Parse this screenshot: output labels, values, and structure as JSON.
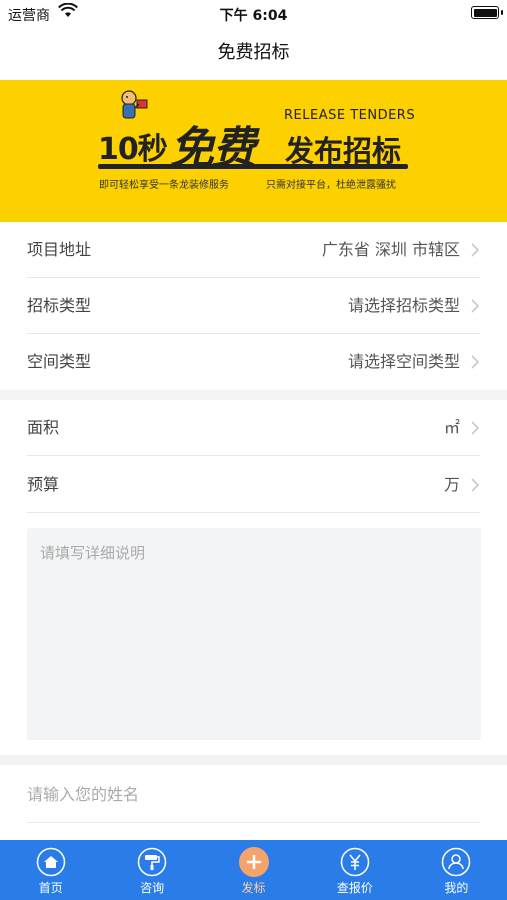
{
  "status_bar": {
    "carrier": "运营商",
    "time": "下午 6:04"
  },
  "nav": {
    "title": "免费招标"
  },
  "banner": {
    "left_text": "10秒",
    "big_text": "免费",
    "right_text": "发布招标",
    "english": "RELEASE TENDERS",
    "tagline_left": "即可轻松享受一条龙装修服务",
    "tagline_right": "只需对接平台，杜绝泄露骚扰"
  },
  "form": {
    "address": {
      "label": "项目地址",
      "value": "广东省 深圳 市辖区"
    },
    "tender_type": {
      "label": "招标类型",
      "value": "请选择招标类型"
    },
    "space_type": {
      "label": "空间类型",
      "value": "请选择空间类型"
    },
    "area": {
      "label": "面积",
      "unit": "㎡"
    },
    "budget": {
      "label": "预算",
      "unit": "万"
    },
    "description_placeholder": "请填写详细说明",
    "name_placeholder": "请输入您的姓名"
  },
  "tabs": [
    {
      "label": "首页",
      "icon": "home-icon"
    },
    {
      "label": "咨询",
      "icon": "paint-roller-icon"
    },
    {
      "label": "发标",
      "icon": "plus-icon",
      "active": true
    },
    {
      "label": "查报价",
      "icon": "yen-icon"
    },
    {
      "label": "我的",
      "icon": "user-icon"
    }
  ],
  "colors": {
    "banner": "#fdd000",
    "tab_bar": "#2a7de8",
    "active_tab": "#f6a36b"
  }
}
